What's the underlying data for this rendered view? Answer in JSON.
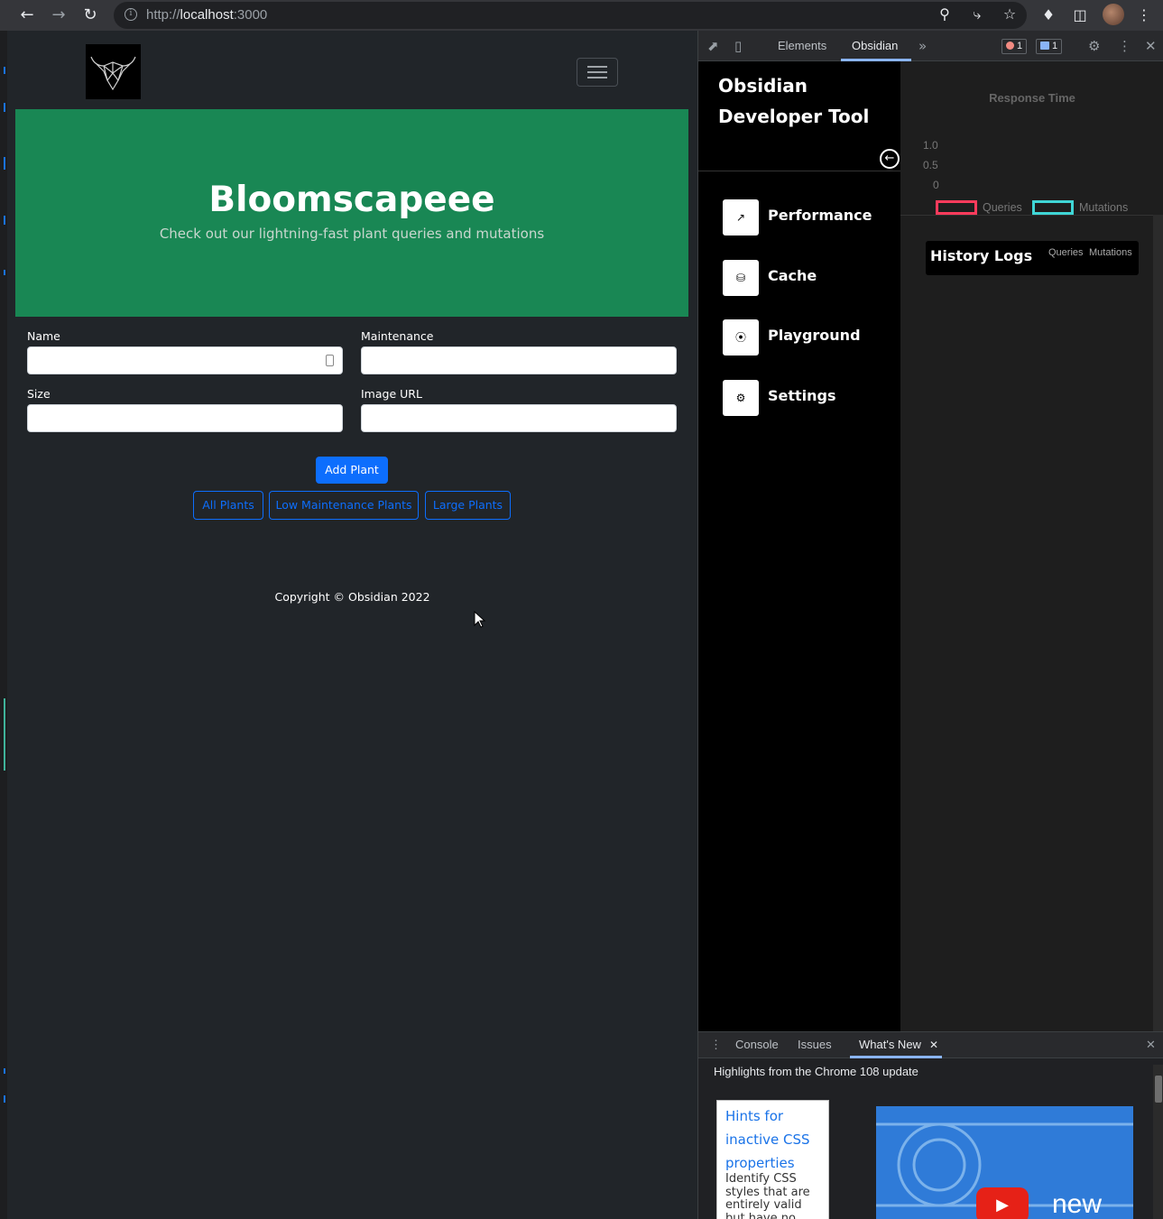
{
  "browser": {
    "url_prefix": "http://",
    "url_host": "localhost",
    "url_suffix": ":3000",
    "icons": [
      "back-icon",
      "forward-icon",
      "reload-icon",
      "zoom-icon",
      "share-icon",
      "star-icon",
      "extensions-icon",
      "side-panel-icon",
      "menu-icon"
    ]
  },
  "app": {
    "hero_title": "Bloomscapeee",
    "hero_subtitle": "Check out our lightning-fast plant queries and mutations",
    "form": {
      "name_label": "Name",
      "maintenance_label": "Maintenance",
      "size_label": "Size",
      "image_url_label": "Image URL",
      "name_value": "",
      "maintenance_value": "",
      "size_value": "",
      "image_url_value": ""
    },
    "add_button": "Add Plant",
    "filters": [
      "All Plants",
      "Low Maintenance Plants",
      "Large Plants"
    ],
    "footer": "Copyright © Obsidian 2022"
  },
  "devtools": {
    "tabs": [
      "Elements",
      "Obsidian"
    ],
    "active_tab": "Obsidian",
    "error_count": "1",
    "message_count": "1",
    "sidebar_title": "Obsidian Developer Tool",
    "menu": [
      {
        "label": "Performance",
        "icon": "chart-icon"
      },
      {
        "label": "Cache",
        "icon": "database-icon"
      },
      {
        "label": "Playground",
        "icon": "compass-icon"
      },
      {
        "label": "Settings",
        "icon": "gear-icon"
      }
    ],
    "chart_data": {
      "type": "line",
      "title": "Response Time",
      "yticks": [
        "1.0",
        "0.5",
        "0"
      ],
      "ylim": [
        0,
        1
      ],
      "series": [
        {
          "name": "Queries",
          "values": [],
          "color": "#ff3b5c"
        },
        {
          "name": "Mutations",
          "values": [],
          "color": "#3fd6d6"
        }
      ],
      "legend": "bottom"
    },
    "history": {
      "title": "History Logs",
      "queries_link": "Queries",
      "mutations_link": "Mutations"
    },
    "drawer": {
      "tabs": [
        "Console",
        "Issues",
        "What's New"
      ],
      "active_tab": "What's New",
      "highlights": "Highlights from the Chrome 108 update",
      "card_title": "Hints for inactive CSS properties",
      "card_desc": "Identify CSS styles that are entirely valid but have no",
      "video_text": "new"
    }
  }
}
